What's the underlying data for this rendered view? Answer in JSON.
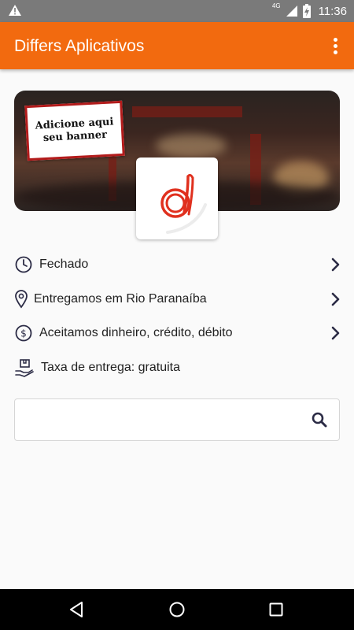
{
  "status_bar": {
    "network": "4G",
    "time": "11:36",
    "icons": [
      "warning-icon",
      "signal-icon",
      "battery-charging-icon"
    ]
  },
  "app_bar": {
    "title": "Differs Aplicativos",
    "menu_icon": "more-vert-icon"
  },
  "banner": {
    "sticker_text_line1": "Adicione aqui",
    "sticker_text_line2": "seu banner",
    "logo_icon": "differs-logo-icon"
  },
  "info": [
    {
      "icon": "clock-icon",
      "label": "Fechado",
      "has_chevron": true
    },
    {
      "icon": "location-pin-icon",
      "label": "Entregamos em Rio Paranaíba",
      "has_chevron": true
    },
    {
      "icon": "dollar-icon",
      "label": "Aceitamos dinheiro, crédito, débito",
      "has_chevron": true
    },
    {
      "icon": "delivery-box-icon",
      "label": "Taxa de entrega: gratuita",
      "has_chevron": false
    }
  ],
  "search": {
    "value": "",
    "placeholder": "",
    "button_icon": "search-icon"
  },
  "nav_bar": {
    "buttons": [
      "back-icon",
      "home-icon",
      "recents-icon"
    ]
  },
  "colors": {
    "app_bar": "#f26a0f",
    "status_bar": "#7a7a7a",
    "logo_red": "#e0301e",
    "icon_dark": "#2b2b45"
  }
}
